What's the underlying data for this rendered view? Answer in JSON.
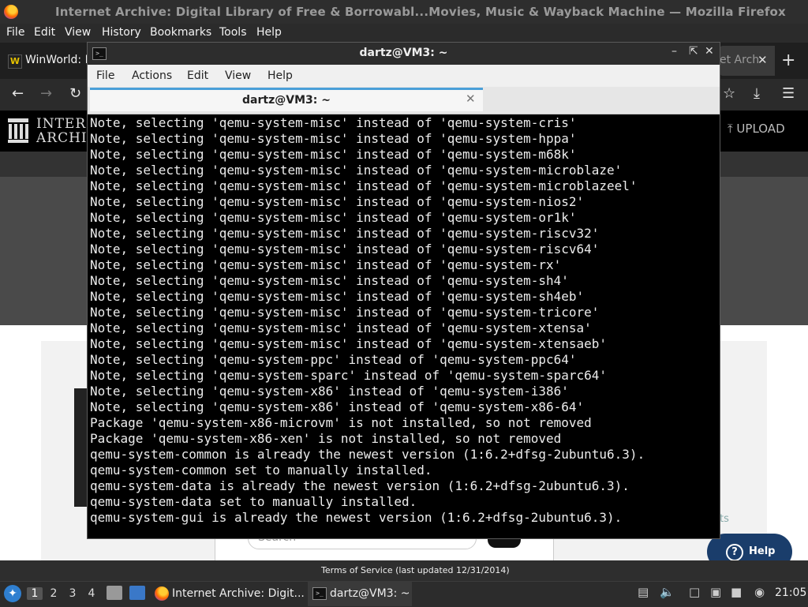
{
  "firefox": {
    "window_title": "Internet Archive: Digital Library of Free & Borrowabl...Movies, Music & Wayback Machine — Mozilla Firefox",
    "menu": [
      "File",
      "Edit",
      "View",
      "History",
      "Bookmarks",
      "Tools",
      "Help"
    ],
    "tabs": {
      "inactive_label": "WinWorld: M",
      "inactive_fav": "W",
      "active_label": "et Arch",
      "close_glyph": "✕",
      "new_tab_glyph": "+"
    },
    "nav_icons": [
      "back-icon",
      "forward-icon",
      "reload-icon",
      "star-icon",
      "download-icon",
      "menu-icon"
    ],
    "status_text": "Terms of Service (last updated 12/31/2014)"
  },
  "archive_page": {
    "logo_line1": "INTERI",
    "logo_line2": "ARCHIV",
    "upload_label": "UPLOAD",
    "search_placeholder": "Search",
    "side_text": "ts",
    "help_label": "Help",
    "help_icon": "?"
  },
  "terminal": {
    "window_title": "dartz@VM3: ~",
    "tab_label": "dartz@VM3: ~",
    "tab_close": "✕",
    "icon_glyph": ">_",
    "menu": [
      "File",
      "Actions",
      "Edit",
      "View",
      "Help"
    ],
    "lines": [
      "Note, selecting 'qemu-system-misc' instead of 'qemu-system-cris'",
      "Note, selecting 'qemu-system-misc' instead of 'qemu-system-hppa'",
      "Note, selecting 'qemu-system-misc' instead of 'qemu-system-m68k'",
      "Note, selecting 'qemu-system-misc' instead of 'qemu-system-microblaze'",
      "Note, selecting 'qemu-system-misc' instead of 'qemu-system-microblazeel'",
      "Note, selecting 'qemu-system-misc' instead of 'qemu-system-nios2'",
      "Note, selecting 'qemu-system-misc' instead of 'qemu-system-or1k'",
      "Note, selecting 'qemu-system-misc' instead of 'qemu-system-riscv32'",
      "Note, selecting 'qemu-system-misc' instead of 'qemu-system-riscv64'",
      "Note, selecting 'qemu-system-misc' instead of 'qemu-system-rx'",
      "Note, selecting 'qemu-system-misc' instead of 'qemu-system-sh4'",
      "Note, selecting 'qemu-system-misc' instead of 'qemu-system-sh4eb'",
      "Note, selecting 'qemu-system-misc' instead of 'qemu-system-tricore'",
      "Note, selecting 'qemu-system-misc' instead of 'qemu-system-xtensa'",
      "Note, selecting 'qemu-system-misc' instead of 'qemu-system-xtensaeb'",
      "Note, selecting 'qemu-system-ppc' instead of 'qemu-system-ppc64'",
      "Note, selecting 'qemu-system-sparc' instead of 'qemu-system-sparc64'",
      "Note, selecting 'qemu-system-x86' instead of 'qemu-system-i386'",
      "Note, selecting 'qemu-system-x86' instead of 'qemu-system-x86-64'",
      "Package 'qemu-system-x86-microvm' is not installed, so not removed",
      "Package 'qemu-system-x86-xen' is not installed, so not removed",
      "qemu-system-common is already the newest version (1:6.2+dfsg-2ubuntu6.3).",
      "qemu-system-common set to manually installed.",
      "qemu-system-data is already the newest version (1:6.2+dfsg-2ubuntu6.3).",
      "qemu-system-data set to manually installed.",
      "qemu-system-gui is already the newest version (1:6.2+dfsg-2ubuntu6.3)."
    ]
  },
  "taskbar": {
    "workspaces": [
      "1",
      "2",
      "3",
      "4"
    ],
    "tasks": [
      "Internet Archive: Digit...",
      "dartz@VM3: ~"
    ],
    "clock": "21:05"
  },
  "colors": {
    "terminal_bg": "#000000",
    "terminal_fg": "#ececec",
    "accent": "#4a9fd8",
    "help_button": "#1a3d6b"
  }
}
